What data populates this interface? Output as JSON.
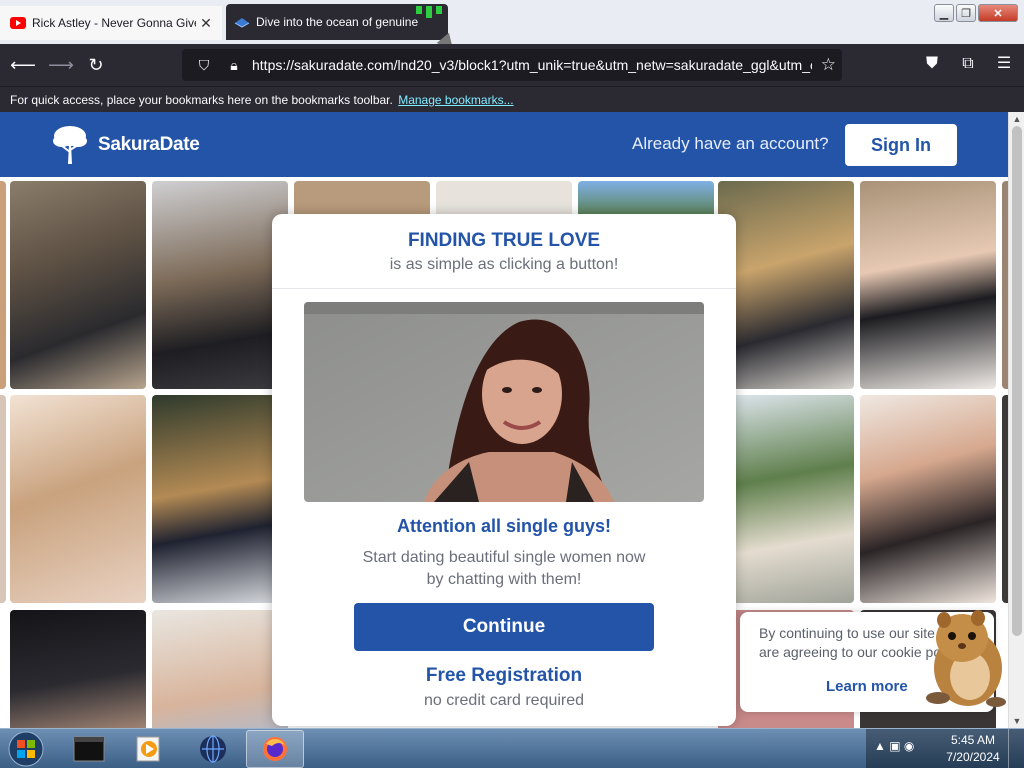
{
  "browser": {
    "tabs": [
      {
        "title": "Rick Astley - Never Gonna Give You Up",
        "close": "✕",
        "icon": "youtube-icon"
      },
      {
        "title": "Dive into the ocean of genuine",
        "icon": "sakura-icon"
      }
    ],
    "url": "https://sakuradate.com/lnd20_v3/block1?utm_unik=true&utm_netw=sakuradate_ggl&utm_c",
    "bookmarks_message": "For quick access, place your bookmarks here on the bookmarks toolbar.",
    "bookmarks_link": "Manage bookmarks..."
  },
  "site": {
    "brand": "SakuraDate",
    "already_account": "Already have an account?",
    "sign_in": "Sign In"
  },
  "modal": {
    "title": "FINDING TRUE LOVE",
    "subtitle": "is as simple as clicking a button!",
    "attention": "Attention all single guys!",
    "description_line1": "Start dating beautiful single women now",
    "description_line2": "by chatting with them!",
    "continue": "Continue",
    "free_registration": "Free Registration",
    "no_card": "no credit card required"
  },
  "cookie": {
    "text_line1": "By continuing to use our site",
    "text_line2": "are agreeing to our cookie po",
    "learn_more": "Learn more"
  },
  "taskbar": {
    "time": "5:45 AM",
    "date": "7/20/2024"
  },
  "colors": {
    "brand_blue": "#2354a8",
    "browser_dark": "#2b2a33"
  }
}
